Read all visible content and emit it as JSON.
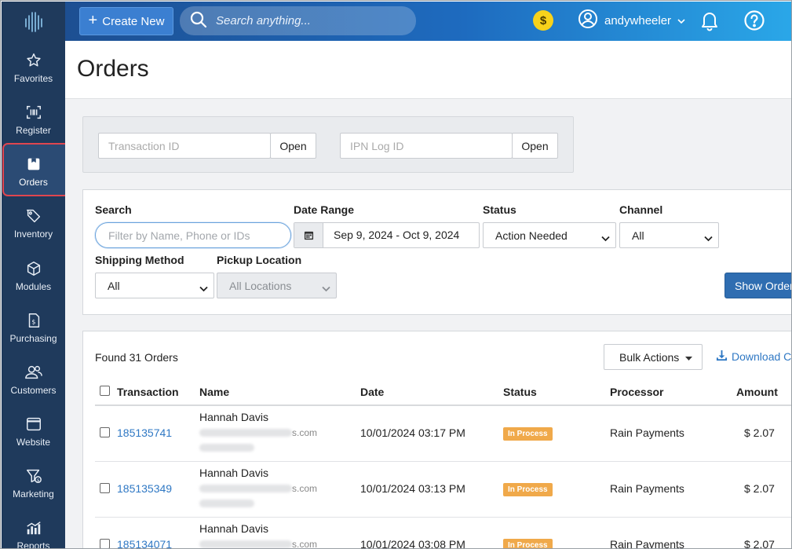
{
  "topbar": {
    "create_label": "Create New",
    "search_placeholder": "Search anything...",
    "coin_symbol": "$",
    "username": "andywheeler"
  },
  "sidebar": {
    "items": [
      {
        "label": "Favorites",
        "icon": "star-icon"
      },
      {
        "label": "Register",
        "icon": "barcode-scanner-icon"
      },
      {
        "label": "Orders",
        "icon": "box-icon",
        "active": true
      },
      {
        "label": "Inventory",
        "icon": "tag-icon"
      },
      {
        "label": "Modules",
        "icon": "cube-icon"
      },
      {
        "label": "Purchasing",
        "icon": "invoice-icon"
      },
      {
        "label": "Customers",
        "icon": "users-icon"
      },
      {
        "label": "Website",
        "icon": "browser-window-icon"
      },
      {
        "label": "Marketing",
        "icon": "funnel-dollar-icon"
      },
      {
        "label": "Reports",
        "icon": "chart-icon"
      }
    ]
  },
  "page": {
    "title": "Orders"
  },
  "lookup": {
    "transaction_placeholder": "Transaction ID",
    "transaction_button": "Open",
    "ipn_placeholder": "IPN Log ID",
    "ipn_button": "Open"
  },
  "filters": {
    "search_label": "Search",
    "search_placeholder": "Filter by Name, Phone or IDs",
    "date_label": "Date Range",
    "date_value": "Sep 9, 2024 - Oct 9, 2024",
    "status_label": "Status",
    "status_value": "Action Needed",
    "channel_label": "Channel",
    "channel_value": "All",
    "shipping_label": "Shipping Method",
    "shipping_value": "All",
    "pickup_label": "Pickup Location",
    "pickup_value": "All Locations",
    "show_button": "Show Orders"
  },
  "orders": {
    "found_text": "Found 31 Orders",
    "bulk_label": "Bulk Actions",
    "download_label": "Download CSV",
    "columns": {
      "transaction": "Transaction",
      "name": "Name",
      "date": "Date",
      "status": "Status",
      "processor": "Processor",
      "amount": "Amount"
    },
    "rows": [
      {
        "transaction": "185135741",
        "name": "Hannah Davis",
        "email_tail": "s.com",
        "date": "10/01/2024 03:17 PM",
        "status": "In Process",
        "processor": "Rain Payments",
        "amount": "$ 2.07"
      },
      {
        "transaction": "185135349",
        "name": "Hannah Davis",
        "email_tail": "s.com",
        "date": "10/01/2024 03:13 PM",
        "status": "In Process",
        "processor": "Rain Payments",
        "amount": "$ 2.07"
      },
      {
        "transaction": "185134071",
        "name": "Hannah Davis",
        "email_tail": "s.com",
        "date": "10/01/2024 03:08 PM",
        "status": "In Process",
        "processor": "Rain Payments",
        "amount": "$ 2.07"
      }
    ]
  },
  "colors": {
    "sidebar_bg": "#1f3a5c",
    "topbar_start": "#1d4f92",
    "topbar_end": "#2aa7e8",
    "link": "#2f78c4",
    "status_badge": "#f0a94a",
    "active_ring": "#e0464f",
    "primary_button": "#2f6db1"
  }
}
